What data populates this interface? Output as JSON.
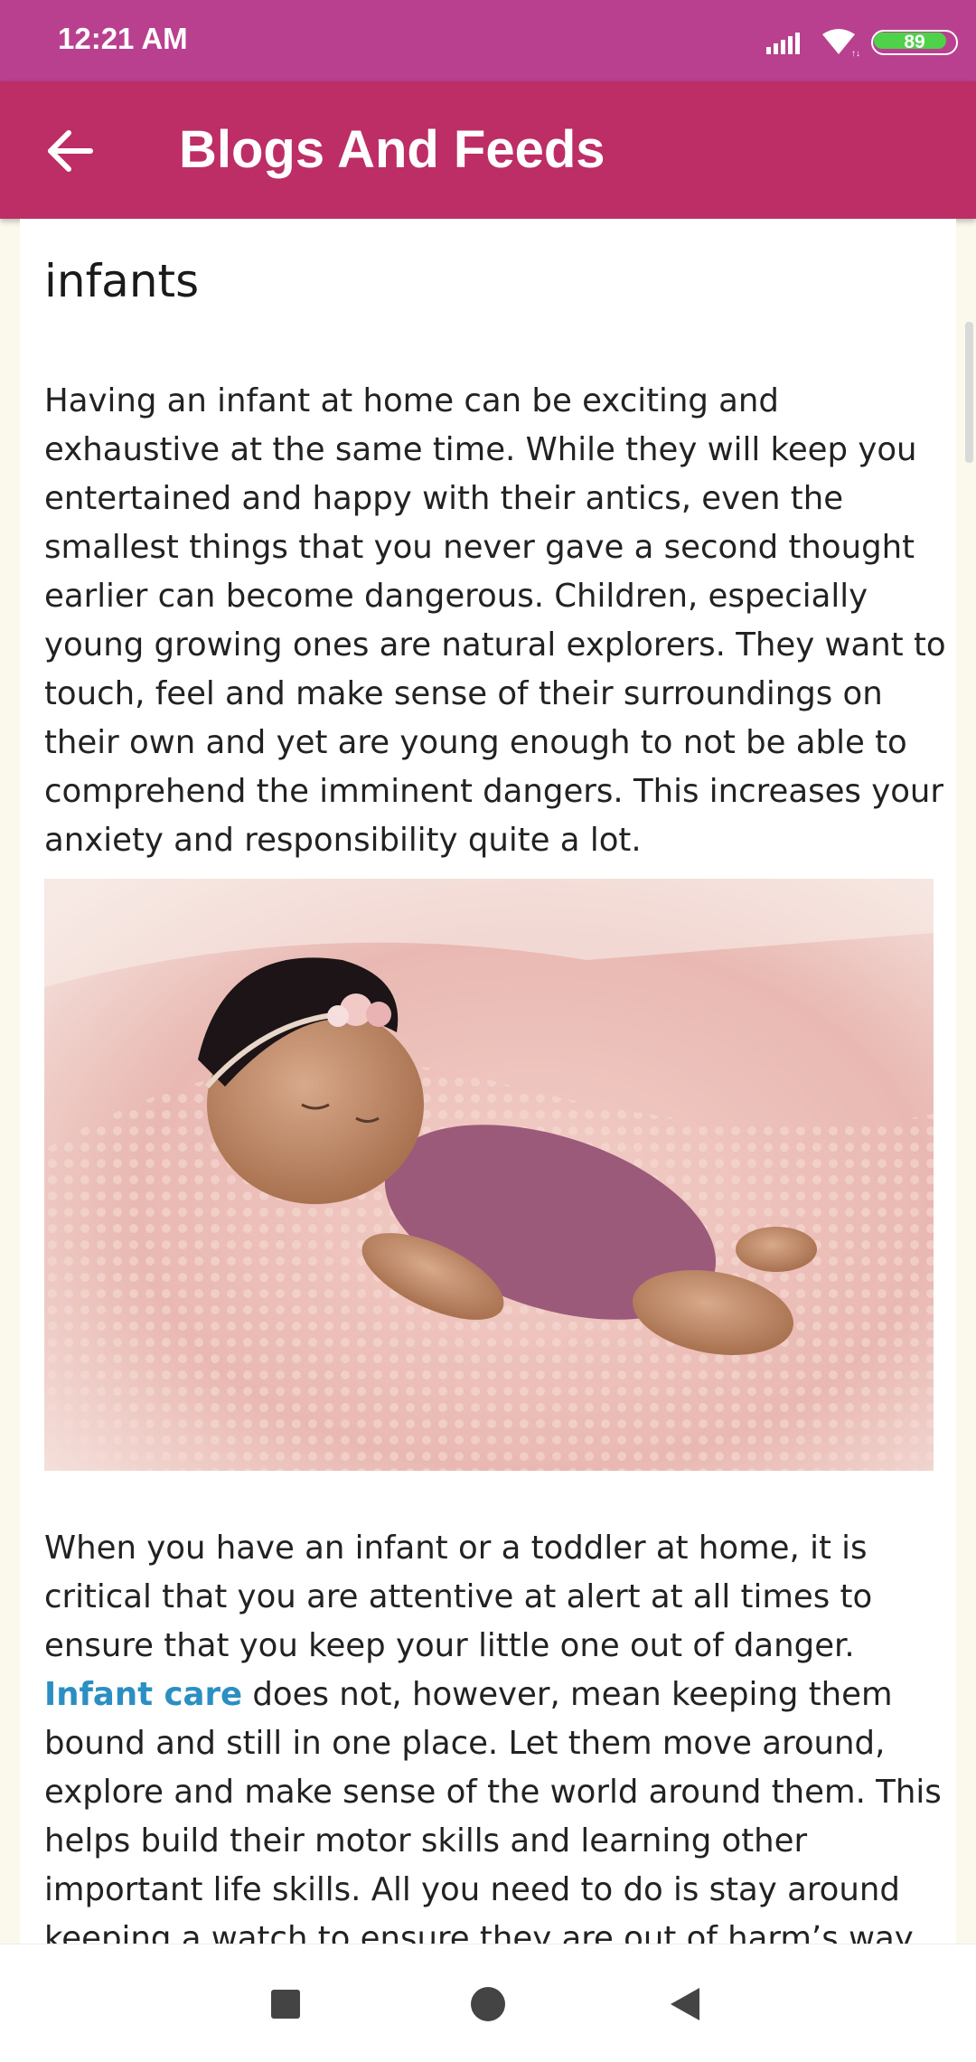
{
  "status_bar": {
    "time": "12:21 AM",
    "battery_level": "89",
    "battery_fraction": 0.89,
    "icons": [
      "signal-icon",
      "wifi-icon",
      "battery-icon"
    ]
  },
  "app_bar": {
    "title": "Blogs And Feeds",
    "back_icon": "arrow-left-icon",
    "color": "#bc2e65"
  },
  "article": {
    "title": "infants",
    "paragraph1": "Having an infant at home can be exciting and exhaustive at the same time. While they will keep you entertained and happy with their antics, even the smallest things that you never gave a second thought earlier can become dangerous. Children, especially young growing ones are natural explorers. They want to touch, feel and make sense of their surroundings on their own and yet are young enough to not be able to comprehend the imminent dangers. This increases your anxiety and responsibility quite a lot.",
    "paragraph2_before": "When you have an infant or a toddler at home, it is critical that you are attentive at alert at all times to ensure that you keep your little one out of danger. ",
    "paragraph2_link": "Infant care",
    "paragraph2_after": " does not, however, mean keeping them bound and still in one place. Let them move around, explore and make sense of the world around them. This helps build their motor skills and learning other important life skills. All you need to do is stay around keeping a watch to ensure they are out of harm’s way.",
    "link_color": "#2b8fc4"
  },
  "nav_bar": {
    "buttons": [
      "recents-square-icon",
      "home-circle-icon",
      "back-triangle-icon"
    ]
  }
}
